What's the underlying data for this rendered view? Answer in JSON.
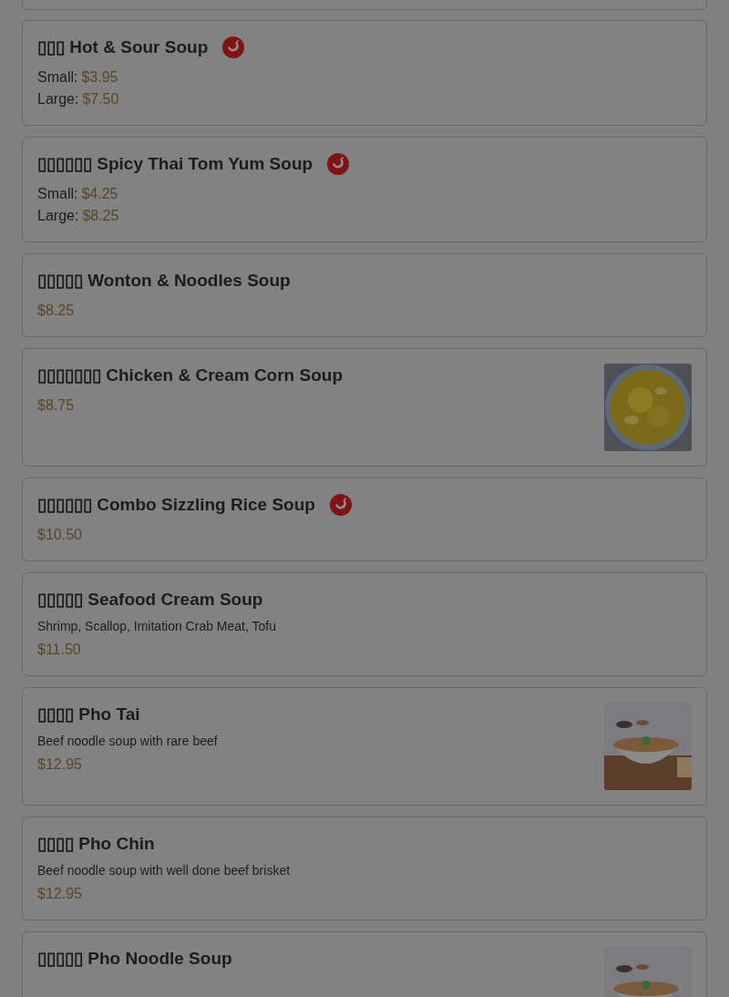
{
  "items": [
    {
      "name": "▯▯▯ Hot & Sour Soup",
      "spicy": true,
      "prices": [
        {
          "label": "Small:",
          "price": "$3.95"
        },
        {
          "label": "Large:",
          "price": "$7.50"
        }
      ]
    },
    {
      "name": "▯▯▯▯▯▯ Spicy Thai Tom Yum Soup",
      "spicy": true,
      "prices": [
        {
          "label": "Small:",
          "price": "$4.25"
        },
        {
          "label": "Large:",
          "price": "$8.25"
        }
      ]
    },
    {
      "name": "▯▯▯▯▯ Wonton & Noodles Soup",
      "spicy": false,
      "prices": [
        {
          "price": "$8.25"
        }
      ]
    },
    {
      "name": "▯▯▯▯▯▯▯ Chicken & Cream Corn Soup",
      "spicy": false,
      "prices": [
        {
          "price": "$8.75"
        }
      ],
      "image": {
        "kind": "picture"
      }
    },
    {
      "name": "▯▯▯▯▯▯ Combo Sizzling Rice Soup",
      "spicy": true,
      "prices": [
        {
          "price": "$10.50"
        }
      ]
    },
    {
      "name": "▯▯▯▯▯ Seafood Cream Soup",
      "spicy": false,
      "description": "Shrimp, Scallop, Imitation Crab Meat, Tofu",
      "prices": [
        {
          "price": "$11.50"
        }
      ]
    },
    {
      "name": "▯▯▯▯ Pho Tai",
      "spicy": false,
      "description": "Beef noodle soup with rare beef",
      "prices": [
        {
          "price": "$12.95"
        }
      ],
      "image": {
        "kind": "picture"
      }
    },
    {
      "name": "▯▯▯▯ Pho Chin",
      "spicy": false,
      "description": "Beef noodle soup with well done beef brisket",
      "prices": [
        {
          "price": "$12.95"
        }
      ]
    },
    {
      "name": "▯▯▯▯▯ Pho Noodle Soup",
      "spicy": false,
      "image": {
        "kind": "picture"
      }
    }
  ]
}
